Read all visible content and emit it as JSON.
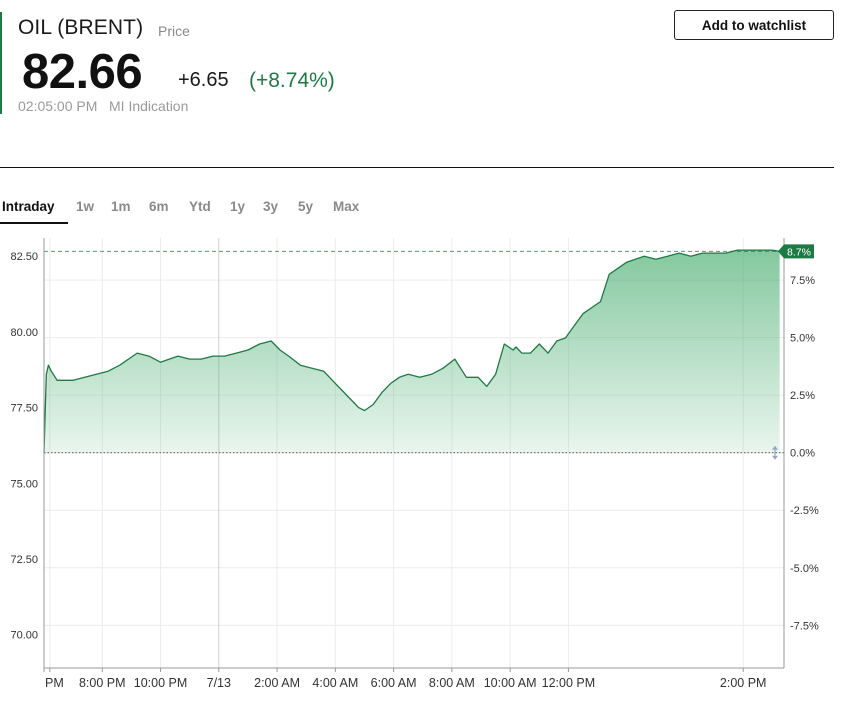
{
  "quote": {
    "instrument": "OIL (BRENT)",
    "price_word": "Price",
    "last": "82.66",
    "change": "+6.65",
    "change_pct": "(+8.74%)",
    "time": "02:05:00 PM",
    "source": "MI Indication"
  },
  "actions": {
    "watchlist_label": "Add to watchlist"
  },
  "tabs": [
    "Intraday",
    "1w",
    "1m",
    "6m",
    "Ytd",
    "1y",
    "3y",
    "5y",
    "Max"
  ],
  "active_tab": "Intraday",
  "colors": {
    "accent": "#1e7a44",
    "line": "#1e7a44",
    "fill": "#4caf73",
    "grid": "#ececec"
  },
  "chart_data": {
    "type": "area",
    "y_left_ticks": [
      "82.50",
      "80.00",
      "77.50",
      "75.00",
      "72.50",
      "70.00"
    ],
    "y_left_values": [
      82.5,
      80.0,
      77.5,
      75.0,
      72.5,
      70.0
    ],
    "y_right_ticks": [
      "7.5%",
      "5.0%",
      "2.5%",
      "0.0%",
      "-2.5%",
      "-5.0%",
      "-7.5%"
    ],
    "y_right_values": [
      7.5,
      5.0,
      2.5,
      0.0,
      -2.5,
      -5.0,
      -7.5
    ],
    "x_ticks": [
      "PM",
      "8:00 PM",
      "10:00 PM",
      "7/13",
      "2:00 AM",
      "4:00 AM",
      "6:00 AM",
      "8:00 AM",
      "10:00 AM",
      "12:00 PM",
      "2:00 PM"
    ],
    "x_tick_hours": [
      6.2,
      8,
      10,
      12,
      14,
      16,
      18,
      20,
      22,
      24,
      30
    ],
    "x_range_hours": [
      6.0,
      31.4
    ],
    "ylim": [
      68.9,
      83.1
    ],
    "previous_close": 76.01,
    "last_value": 82.66,
    "last_pct_label": "8.7%",
    "series": [
      {
        "x": [
          6.0,
          6.08,
          6.15,
          6.25,
          6.45,
          6.7,
          7.0,
          7.4,
          7.8,
          8.2,
          8.6,
          8.9,
          9.2,
          9.6,
          10.0,
          10.3,
          10.6,
          11.0,
          11.4,
          11.8,
          12.2,
          12.6,
          13.0,
          13.4,
          13.8,
          14.1,
          14.4,
          14.8,
          15.2,
          15.6,
          16.0,
          16.4,
          16.8,
          17.0,
          17.3,
          17.6,
          17.9,
          18.2,
          18.5,
          18.9,
          19.3,
          19.7,
          20.1,
          20.5,
          20.9,
          21.2,
          21.5,
          21.8,
          22.1,
          22.2,
          22.4,
          22.7,
          23.0,
          23.3,
          23.6,
          23.9,
          24.2,
          24.5,
          24.8,
          25.1,
          25.4,
          25.7,
          26.0,
          26.3,
          26.6,
          27.0,
          27.4,
          27.8,
          28.2,
          28.6,
          29.0,
          29.4,
          29.8,
          30.2,
          30.6,
          31.0,
          31.25
        ],
        "y": [
          76.01,
          78.6,
          78.9,
          78.7,
          78.4,
          78.4,
          78.4,
          78.5,
          78.6,
          78.7,
          78.9,
          79.1,
          79.3,
          79.2,
          79.0,
          79.1,
          79.2,
          79.1,
          79.1,
          79.2,
          79.2,
          79.3,
          79.4,
          79.6,
          79.7,
          79.4,
          79.2,
          78.9,
          78.8,
          78.7,
          78.3,
          77.9,
          77.5,
          77.4,
          77.6,
          78.0,
          78.3,
          78.5,
          78.6,
          78.5,
          78.6,
          78.8,
          79.1,
          78.5,
          78.5,
          78.2,
          78.6,
          79.6,
          79.4,
          79.5,
          79.3,
          79.3,
          79.6,
          79.3,
          79.7,
          79.8,
          80.2,
          80.6,
          80.8,
          81.0,
          81.9,
          82.1,
          82.3,
          82.4,
          82.5,
          82.4,
          82.5,
          82.6,
          82.5,
          82.6,
          82.6,
          82.6,
          82.7,
          82.7,
          82.7,
          82.7,
          82.66
        ]
      }
    ],
    "grid": true,
    "legend": "none"
  }
}
